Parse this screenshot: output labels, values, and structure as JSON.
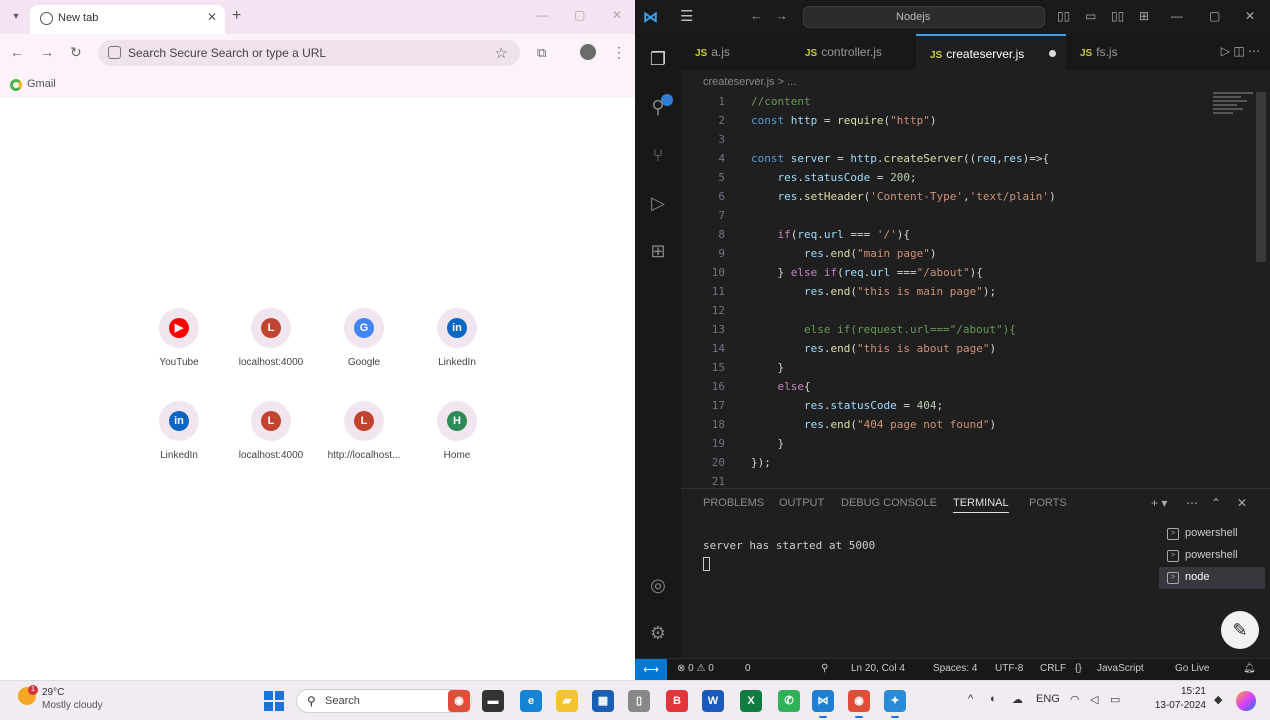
{
  "browser": {
    "tab_title": "New tab",
    "omnibox_placeholder": "Search Secure Search or type a URL",
    "bookmark_label": "Gmail",
    "shortcuts": [
      {
        "label": "YouTube",
        "icon": "youtube-icon",
        "glyph": "▶",
        "color": "#ff0000"
      },
      {
        "label": "localhost:4000",
        "icon": "globe-icon",
        "glyph": "L",
        "color": "#c0442e"
      },
      {
        "label": "Google",
        "icon": "google-icon",
        "glyph": "G",
        "color": "#4285f4"
      },
      {
        "label": "LinkedIn",
        "icon": "linkedin-icon",
        "glyph": "in",
        "color": "#0a66c2"
      },
      {
        "label": "LinkedIn",
        "icon": "linkedin-icon",
        "glyph": "in",
        "color": "#0a66c2"
      },
      {
        "label": "localhost:4000",
        "icon": "globe-icon",
        "glyph": "L",
        "color": "#c0442e"
      },
      {
        "label": "http://localhost...",
        "icon": "globe-icon",
        "glyph": "L",
        "color": "#c0442e"
      },
      {
        "label": "Home",
        "icon": "home-icon",
        "glyph": "H",
        "color": "#2e8b57"
      }
    ]
  },
  "vscode": {
    "search_text": "Nodejs",
    "tabs": [
      {
        "label": "a.js",
        "active": false
      },
      {
        "label": "controller.js",
        "active": false
      },
      {
        "label": "createserver.js",
        "active": true
      },
      {
        "label": "fs.js",
        "active": false
      }
    ],
    "breadcrumb": "createserver.js > ...",
    "code": [
      {
        "n": "1",
        "html": "<span class='c-comment'>//content</span>"
      },
      {
        "n": "2",
        "html": "<span class='c-kw'>const</span> <span class='c-var'>http</span> = <span class='c-fn'>require</span>(<span class='c-str'>\"http\"</span>)"
      },
      {
        "n": "3",
        "html": ""
      },
      {
        "n": "4",
        "html": "<span class='c-kw'>const</span> <span class='c-var'>server</span> = <span class='c-var'>http</span>.<span class='c-fn'>createServer</span>((<span class='c-var'>req</span>,<span class='c-var'>res</span>)=>{"
      },
      {
        "n": "5",
        "html": "    <span class='c-var'>res</span>.<span class='c-var'>statusCode</span> = <span class='c-num'>200</span>;"
      },
      {
        "n": "6",
        "html": "    <span class='c-var'>res</span>.<span class='c-fn'>setHeader</span>(<span class='c-str'>'Content-Type'</span>,<span class='c-str'>'text/plain'</span>)"
      },
      {
        "n": "7",
        "html": ""
      },
      {
        "n": "8",
        "html": "    <span class='c-ctrl'>if</span>(<span class='c-var'>req</span>.<span class='c-var'>url</span> === <span class='c-str'>'/'</span>){"
      },
      {
        "n": "9",
        "html": "        <span class='c-var'>res</span>.<span class='c-fn'>end</span>(<span class='c-str'>\"main page\"</span>)"
      },
      {
        "n": "10",
        "html": "    } <span class='c-ctrl'>else if</span>(<span class='c-var'>req</span>.<span class='c-var'>url</span> ===<span class='c-str'>\"/about\"</span>){"
      },
      {
        "n": "11",
        "html": "        <span class='c-var'>res</span>.<span class='c-fn'>end</span>(<span class='c-str'>\"this is main page\"</span>);"
      },
      {
        "n": "12",
        "html": ""
      },
      {
        "n": "13",
        "html": "        <span class='c-comment'>else if(request.url===\"/about\"){</span>"
      },
      {
        "n": "14",
        "html": "        <span class='c-var'>res</span>.<span class='c-fn'>end</span>(<span class='c-str'>\"this is about page\"</span>)"
      },
      {
        "n": "15",
        "html": "    }"
      },
      {
        "n": "16",
        "html": "    <span class='c-ctrl'>else</span>{"
      },
      {
        "n": "17",
        "html": "        <span class='c-var'>res</span>.<span class='c-var'>statusCode</span> = <span class='c-num'>404</span>;"
      },
      {
        "n": "18",
        "html": "        <span class='c-var'>res</span>.<span class='c-fn'>end</span>(<span class='c-str'>\"404 page not found\"</span>)"
      },
      {
        "n": "19",
        "html": "    }"
      },
      {
        "n": "20",
        "html": "});"
      },
      {
        "n": "21",
        "html": ""
      }
    ],
    "panel_tabs": [
      "PROBLEMS",
      "OUTPUT",
      "DEBUG CONSOLE",
      "TERMINAL",
      "PORTS"
    ],
    "active_panel_tab": "TERMINAL",
    "terminal_output": "server has started at 5000",
    "terminals": [
      {
        "label": "powershell",
        "active": false
      },
      {
        "label": "powershell",
        "active": false
      },
      {
        "label": "node",
        "active": true
      }
    ],
    "status": {
      "left": "⊗ 0 ⚠ 0",
      "warnings": "0",
      "position": "Ln 20, Col 4",
      "spaces": "Spaces: 4",
      "encoding": "UTF-8",
      "eol": "CRLF",
      "language": "JavaScript",
      "live": "Go Live"
    }
  },
  "taskbar": {
    "weather_temp": "29°C",
    "weather_desc": "Mostly cloudy",
    "search_placeholder": "Search",
    "time": "15:21",
    "date": "13-07-2024",
    "language": "ENG",
    "apps": [
      {
        "name": "chrome-icon",
        "glyph": "◉",
        "color": "#e04e3a"
      },
      {
        "name": "file-explorer-icon",
        "glyph": "▬",
        "color": "#333"
      },
      {
        "name": "edge-icon",
        "glyph": "e",
        "color": "#1684d6"
      },
      {
        "name": "folder-icon",
        "glyph": "▰",
        "color": "#f4c430"
      },
      {
        "name": "store-icon",
        "glyph": "▦",
        "color": "#1a5fb4"
      },
      {
        "name": "notepad-icon",
        "glyph": "▯",
        "color": "#888"
      },
      {
        "name": "brave-icon",
        "glyph": "B",
        "color": "#e2343a"
      },
      {
        "name": "word-icon",
        "glyph": "W",
        "color": "#185abd"
      },
      {
        "name": "excel-icon",
        "glyph": "X",
        "color": "#107c41"
      },
      {
        "name": "whatsapp-icon",
        "glyph": "✆",
        "color": "#2fb35a"
      },
      {
        "name": "vscode-icon",
        "glyph": "⋈",
        "color": "#1e7fd3"
      },
      {
        "name": "chrome-running-icon",
        "glyph": "◉",
        "color": "#e04e3a"
      },
      {
        "name": "devtools-icon",
        "glyph": "✦",
        "color": "#2b8bd6"
      }
    ]
  }
}
